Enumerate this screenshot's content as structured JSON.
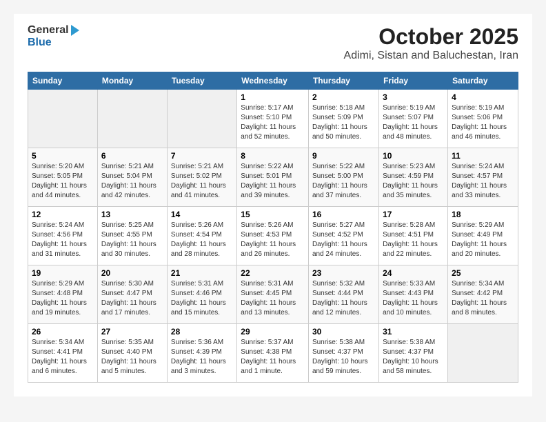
{
  "header": {
    "logo_general": "General",
    "logo_blue": "Blue",
    "month_title": "October 2025",
    "location": "Adimi, Sistan and Baluchestan, Iran"
  },
  "weekdays": [
    "Sunday",
    "Monday",
    "Tuesday",
    "Wednesday",
    "Thursday",
    "Friday",
    "Saturday"
  ],
  "weeks": [
    [
      {
        "day": "",
        "info": ""
      },
      {
        "day": "",
        "info": ""
      },
      {
        "day": "",
        "info": ""
      },
      {
        "day": "1",
        "info": "Sunrise: 5:17 AM\nSunset: 5:10 PM\nDaylight: 11 hours\nand 52 minutes."
      },
      {
        "day": "2",
        "info": "Sunrise: 5:18 AM\nSunset: 5:09 PM\nDaylight: 11 hours\nand 50 minutes."
      },
      {
        "day": "3",
        "info": "Sunrise: 5:19 AM\nSunset: 5:07 PM\nDaylight: 11 hours\nand 48 minutes."
      },
      {
        "day": "4",
        "info": "Sunrise: 5:19 AM\nSunset: 5:06 PM\nDaylight: 11 hours\nand 46 minutes."
      }
    ],
    [
      {
        "day": "5",
        "info": "Sunrise: 5:20 AM\nSunset: 5:05 PM\nDaylight: 11 hours\nand 44 minutes."
      },
      {
        "day": "6",
        "info": "Sunrise: 5:21 AM\nSunset: 5:04 PM\nDaylight: 11 hours\nand 42 minutes."
      },
      {
        "day": "7",
        "info": "Sunrise: 5:21 AM\nSunset: 5:02 PM\nDaylight: 11 hours\nand 41 minutes."
      },
      {
        "day": "8",
        "info": "Sunrise: 5:22 AM\nSunset: 5:01 PM\nDaylight: 11 hours\nand 39 minutes."
      },
      {
        "day": "9",
        "info": "Sunrise: 5:22 AM\nSunset: 5:00 PM\nDaylight: 11 hours\nand 37 minutes."
      },
      {
        "day": "10",
        "info": "Sunrise: 5:23 AM\nSunset: 4:59 PM\nDaylight: 11 hours\nand 35 minutes."
      },
      {
        "day": "11",
        "info": "Sunrise: 5:24 AM\nSunset: 4:57 PM\nDaylight: 11 hours\nand 33 minutes."
      }
    ],
    [
      {
        "day": "12",
        "info": "Sunrise: 5:24 AM\nSunset: 4:56 PM\nDaylight: 11 hours\nand 31 minutes."
      },
      {
        "day": "13",
        "info": "Sunrise: 5:25 AM\nSunset: 4:55 PM\nDaylight: 11 hours\nand 30 minutes."
      },
      {
        "day": "14",
        "info": "Sunrise: 5:26 AM\nSunset: 4:54 PM\nDaylight: 11 hours\nand 28 minutes."
      },
      {
        "day": "15",
        "info": "Sunrise: 5:26 AM\nSunset: 4:53 PM\nDaylight: 11 hours\nand 26 minutes."
      },
      {
        "day": "16",
        "info": "Sunrise: 5:27 AM\nSunset: 4:52 PM\nDaylight: 11 hours\nand 24 minutes."
      },
      {
        "day": "17",
        "info": "Sunrise: 5:28 AM\nSunset: 4:51 PM\nDaylight: 11 hours\nand 22 minutes."
      },
      {
        "day": "18",
        "info": "Sunrise: 5:29 AM\nSunset: 4:49 PM\nDaylight: 11 hours\nand 20 minutes."
      }
    ],
    [
      {
        "day": "19",
        "info": "Sunrise: 5:29 AM\nSunset: 4:48 PM\nDaylight: 11 hours\nand 19 minutes."
      },
      {
        "day": "20",
        "info": "Sunrise: 5:30 AM\nSunset: 4:47 PM\nDaylight: 11 hours\nand 17 minutes."
      },
      {
        "day": "21",
        "info": "Sunrise: 5:31 AM\nSunset: 4:46 PM\nDaylight: 11 hours\nand 15 minutes."
      },
      {
        "day": "22",
        "info": "Sunrise: 5:31 AM\nSunset: 4:45 PM\nDaylight: 11 hours\nand 13 minutes."
      },
      {
        "day": "23",
        "info": "Sunrise: 5:32 AM\nSunset: 4:44 PM\nDaylight: 11 hours\nand 12 minutes."
      },
      {
        "day": "24",
        "info": "Sunrise: 5:33 AM\nSunset: 4:43 PM\nDaylight: 11 hours\nand 10 minutes."
      },
      {
        "day": "25",
        "info": "Sunrise: 5:34 AM\nSunset: 4:42 PM\nDaylight: 11 hours\nand 8 minutes."
      }
    ],
    [
      {
        "day": "26",
        "info": "Sunrise: 5:34 AM\nSunset: 4:41 PM\nDaylight: 11 hours\nand 6 minutes."
      },
      {
        "day": "27",
        "info": "Sunrise: 5:35 AM\nSunset: 4:40 PM\nDaylight: 11 hours\nand 5 minutes."
      },
      {
        "day": "28",
        "info": "Sunrise: 5:36 AM\nSunset: 4:39 PM\nDaylight: 11 hours\nand 3 minutes."
      },
      {
        "day": "29",
        "info": "Sunrise: 5:37 AM\nSunset: 4:38 PM\nDaylight: 11 hours\nand 1 minute."
      },
      {
        "day": "30",
        "info": "Sunrise: 5:38 AM\nSunset: 4:37 PM\nDaylight: 10 hours\nand 59 minutes."
      },
      {
        "day": "31",
        "info": "Sunrise: 5:38 AM\nSunset: 4:37 PM\nDaylight: 10 hours\nand 58 minutes."
      },
      {
        "day": "",
        "info": ""
      }
    ]
  ]
}
